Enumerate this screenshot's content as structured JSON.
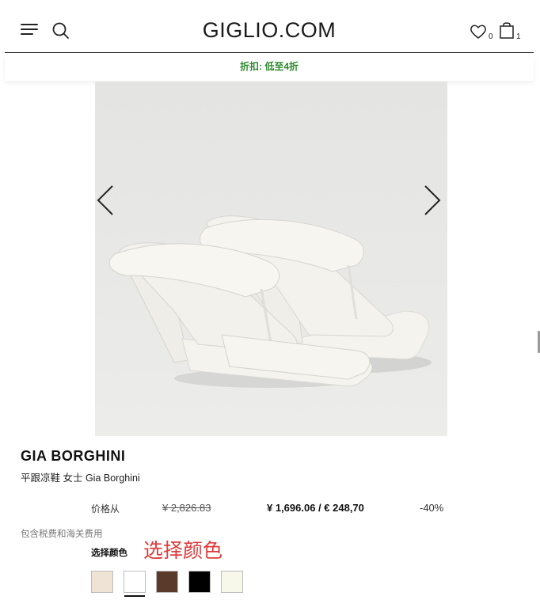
{
  "header": {
    "logo": "GIGLIO.COM",
    "menu_icon": "hamburger-menu-icon",
    "search_icon": "search-icon",
    "wishlist_icon": "heart-icon",
    "wishlist_count": "0",
    "bag_icon": "shopping-bag-icon",
    "bag_count": "1"
  },
  "promo": {
    "text": "折扣: 低至4折",
    "color": "#2b8a2b"
  },
  "gallery": {
    "prev_icon": "chevron-left-icon",
    "next_icon": "chevron-right-icon"
  },
  "product": {
    "brand": "GIA BORGHINI",
    "subtitle": "平跟凉鞋 女士 Gia Borghini",
    "price_from_label": "价格从",
    "old_price": "¥ 2,826.83",
    "new_price": "¥ 1,696.06 / € 248,70",
    "discount": "-40%",
    "tax_note": "包含税费和海关费用",
    "color_label": "选择颜色",
    "color_annotation": "选择颜色",
    "annotation_color": "#e03a3a",
    "swatches": [
      {
        "color": "#efe3d6",
        "selected": false
      },
      {
        "color": "#ffffff",
        "selected": true
      },
      {
        "color": "#5a3a2b",
        "selected": false
      },
      {
        "color": "#000000",
        "selected": false
      },
      {
        "color": "#f8f8ea",
        "selected": false
      }
    ]
  }
}
